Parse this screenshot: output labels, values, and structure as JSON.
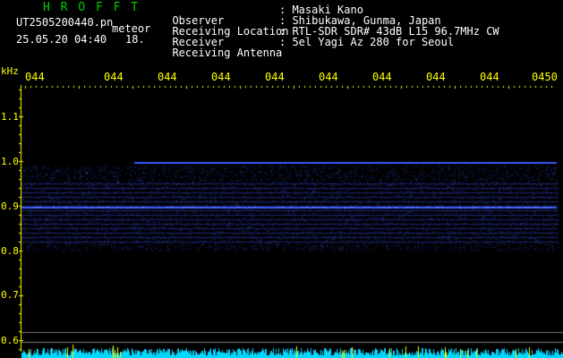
{
  "header": {
    "station": "H R O F F T",
    "filename": "UT2505200440.pn",
    "meteor_label": "meteor",
    "datetime": "25.05.20 04:40",
    "count": "18.",
    "info": [
      {
        "key": "Observer",
        "value": ": Masaki Kano"
      },
      {
        "key": "Receiving Location",
        "value": ": Shibukawa, Gunma, Japan"
      },
      {
        "key": "Receiver",
        "value": ": RTL-SDR SDR# 43dB L15 96.7MHz CW"
      },
      {
        "key": "Receiving Antenna",
        "value": ": 5el Yagi Az 280 for Seoul"
      }
    ]
  },
  "axis": {
    "unit": "kHz",
    "time_ticks": [
      "044",
      "044",
      "044",
      "044",
      "044",
      "044",
      "044",
      "044",
      "044",
      "0450"
    ],
    "freq_labels": [
      "1.1",
      "1.0",
      "0.9",
      "0.8",
      "0.7",
      "0.6"
    ]
  },
  "colors": {
    "background": "#000000",
    "text": "#ffffff",
    "station": "#00d000",
    "axis": "#ffff00",
    "signal": "#3a5cff",
    "noise_floor": "#00d8ff"
  }
}
